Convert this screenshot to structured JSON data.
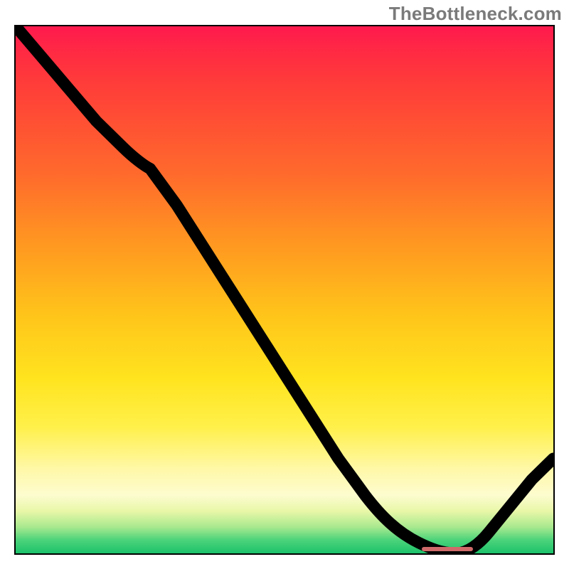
{
  "watermark": "TheBottleneck.com",
  "colors": {
    "gradient_top": "#ff1a4d",
    "gradient_mid": "#ffe41f",
    "gradient_bottom": "#1cc26b",
    "curve_stroke": "#000000",
    "marker": "#d06a6a",
    "frame_border": "#000000"
  },
  "chart_data": {
    "type": "line",
    "title": "",
    "xlabel": "",
    "ylabel": "",
    "xlim": [
      0,
      100
    ],
    "ylim": [
      0,
      100
    ],
    "grid": false,
    "legend": null,
    "series": [
      {
        "name": "curve",
        "note": "values estimated from pixels; y is % of plot height from bottom",
        "x": [
          0,
          5,
          10,
          15,
          20,
          25,
          30,
          35,
          40,
          45,
          50,
          55,
          60,
          65,
          70,
          75,
          80,
          82,
          85,
          90,
          95,
          100
        ],
        "y": [
          100,
          94,
          88,
          82,
          77,
          73,
          66,
          58,
          50,
          42,
          34,
          26,
          18,
          11,
          6,
          2,
          0,
          0,
          2,
          7,
          13,
          18
        ]
      }
    ],
    "marker": {
      "note": "short horizontal bar at curve minimum",
      "x_start": 76,
      "x_end": 85,
      "y": 1
    }
  }
}
